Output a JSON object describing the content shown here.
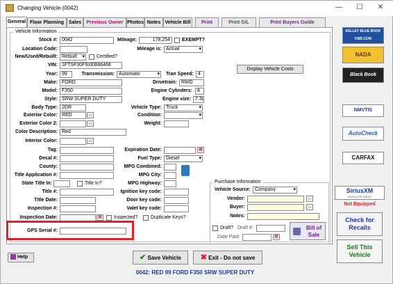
{
  "window": {
    "title": "Changing Vehicle  (0042)"
  },
  "tabs": [
    {
      "label": "General"
    },
    {
      "label": "Floor Planning"
    },
    {
      "label": "Sales"
    },
    {
      "label": "Previous Owner"
    },
    {
      "label": "Photos"
    },
    {
      "label": "Notes"
    },
    {
      "label": "Vehicle Bill"
    },
    {
      "label": "Print"
    },
    {
      "label": "Print G/L"
    },
    {
      "label": "Print Buyers Guide"
    }
  ],
  "vehicle_info": {
    "group_label": "Vehicle Information",
    "stock_label": "Stock #:",
    "stock": "0042",
    "mileage_label": "Mileage:",
    "mileage": "178,254",
    "exempt_label": "EXEMPT?",
    "location_label": "Location Code:",
    "location": "",
    "mileage_is_label": "Mileage is:",
    "mileage_is": "Actual",
    "nur_label": "New/Used/Rebuilt:",
    "nur": "Rebuilt",
    "certified_label": "Certified?",
    "vin_label": "VIN:",
    "vin": "1FTSF30F9XEB86468",
    "year_label": "Year:",
    "year": "99",
    "transmission_label": "Transmission:",
    "transmission": "Automatic",
    "tran_speed_label": "Tran Speed:",
    "tran_speed": "4",
    "make_label": "Make:",
    "make": "FORD",
    "drivetrain_label": "Drivetrain:",
    "drivetrain": "RWD",
    "model_label": "Model:",
    "model": "F350",
    "engine_cyl_label": "Engine Cylinders:",
    "engine_cyl": "8",
    "style_label": "Style:",
    "style": "SRW SUPER DUTY",
    "engine_size_label": "Engine size:",
    "engine_size": "7.3L",
    "display_costs": "Display Vehicle Costs",
    "body_type_label": "Body Type:",
    "body_type": "2DR",
    "vehicle_type_label": "Vehicle Type:",
    "vehicle_type": "Truck",
    "ext_color_label": "Exterior Color:",
    "ext_color": "RED",
    "condition_label": "Condition:",
    "condition": "",
    "ext_color2_label": "Exterior Color 2:",
    "ext_color2": "",
    "weight_label": "Weight:",
    "weight": "",
    "color_desc_label": "Color Description:",
    "color_desc": "Red",
    "int_color_label": "Interior Color:",
    "int_color": "",
    "tag_label": "Tag:",
    "tag": "",
    "exp_date_label": "Expiration Date:",
    "exp_date": "",
    "decal_label": "Decal #:",
    "decal": "",
    "fuel_type_label": "Fuel Type:",
    "fuel_type": "Diesel",
    "county_label": "County:",
    "county": "",
    "mpg_combined_label": "MPG Combined:",
    "mpg_combined": "",
    "title_app_label": "Title Application #:",
    "title_app": "",
    "mpg_city_label": "MPG City:",
    "mpg_city": "",
    "state_title_label": "State Title In:",
    "state_title": "",
    "title_in_label": "Title In?",
    "mpg_highway_label": "MPG Highway:",
    "mpg_highway": "",
    "title_no_label": "Title #:",
    "title_no": "",
    "ign_key_label": "Ignition key code:",
    "ign_key": "",
    "title_date_label": "Title Date:",
    "title_date": "",
    "door_key_label": "Door key code:",
    "door_key": "",
    "inspection_label": "Inspection #:",
    "inspection": "",
    "valet_key_label": "Valet key code:",
    "valet_key": "",
    "insp_date_label": "Inspection Date:",
    "insp_date": "",
    "inspected_label": "Inspected?",
    "dup_keys_label": "Duplicate Keys?",
    "gps_label": "GPS Serial #:",
    "gps": ""
  },
  "purchase": {
    "group_label": "Purchase Information",
    "source_label": "Vehicle Source:",
    "source": "Company",
    "vendor_label": "Vendor:",
    "vendor": "",
    "buyer_label": "Buyer:",
    "buyer": "",
    "notes_label": "Notes:",
    "notes": "",
    "draft_label": "Draft?",
    "draft_no_label": "Draft #:",
    "draft_no": "",
    "date_paid_label": "Date Paid:",
    "date_paid": "",
    "bill_of_sale": "Bill of Sale"
  },
  "side": {
    "kbb": "KELLEY BLUE BOOK KBB.COM",
    "nada": "NADA",
    "blackbook": "Black Book",
    "nmvtis": "NMVTIS",
    "autocheck": "AutoCheck",
    "carfax": "CARFAX",
    "sirius": "SiriusXM",
    "sirius_sub": "SATELLITE RADIO",
    "not_equipped": "Not Equipped",
    "check_recalls": "Check for Recalls",
    "sell_vehicle": "Sell This Vehicle"
  },
  "footer": {
    "help": "Help",
    "save": "Save Vehicle",
    "exit": "Exit - Do not save",
    "status": "0042: RED 99 FORD F350 SRW SUPER DUTY"
  },
  "colors": {
    "highlight": "#e0202a",
    "link_blue": "#1a3a9a",
    "green": "#1b7a1b"
  }
}
